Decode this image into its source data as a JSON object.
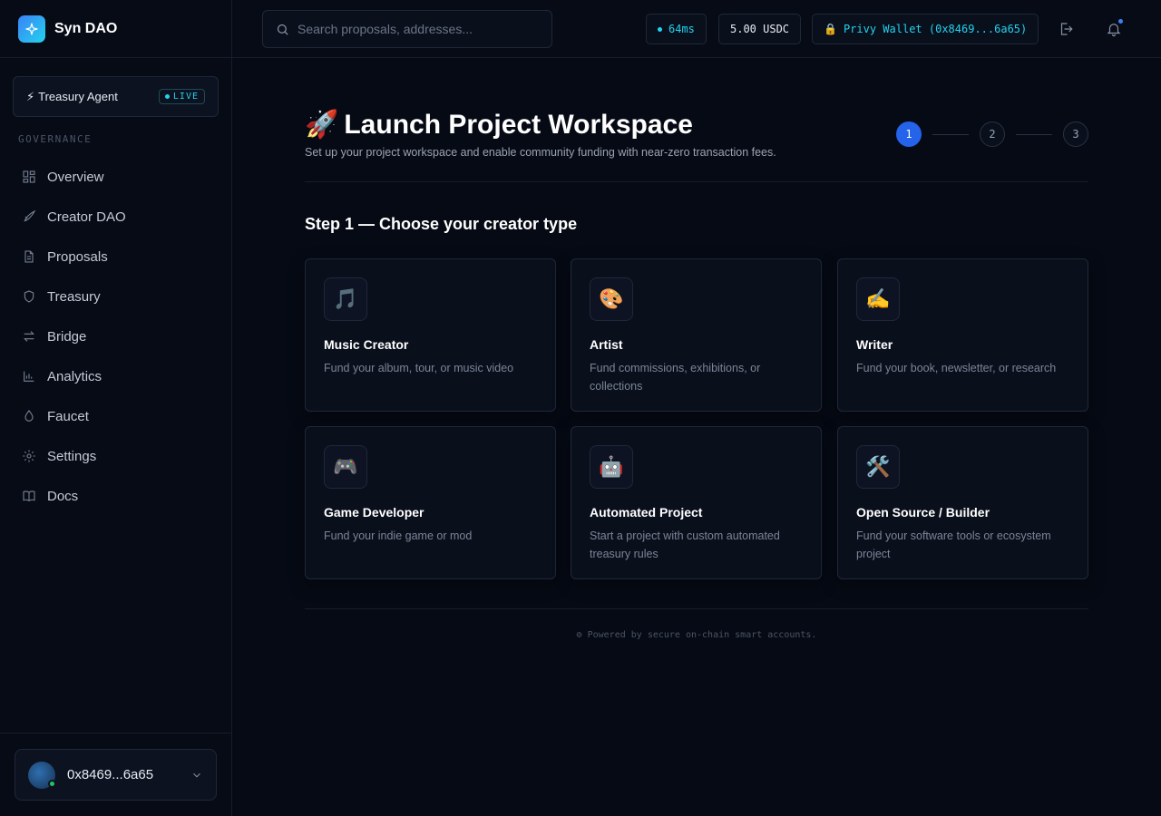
{
  "brand": {
    "name": "Syn DAO"
  },
  "agent": {
    "label": "Treasury Agent",
    "status": "LIVE"
  },
  "sidebar": {
    "section_label": "GOVERNANCE",
    "items": [
      {
        "label": "Overview",
        "icon": "grid-icon"
      },
      {
        "label": "Creator DAO",
        "icon": "rocket-icon"
      },
      {
        "label": "Proposals",
        "icon": "document-icon"
      },
      {
        "label": "Treasury",
        "icon": "shield-icon"
      },
      {
        "label": "Bridge",
        "icon": "arrows-icon"
      },
      {
        "label": "Analytics",
        "icon": "bar-chart-icon"
      },
      {
        "label": "Faucet",
        "icon": "droplet-icon"
      },
      {
        "label": "Settings",
        "icon": "gear-icon"
      },
      {
        "label": "Docs",
        "icon": "book-icon"
      }
    ],
    "user": {
      "address": "0x8469...6a65"
    }
  },
  "topbar": {
    "search_placeholder": "Search proposals, addresses...",
    "latency": "64ms",
    "balance": "5.00 USDC",
    "wallet": "Privy Wallet (0x8469...6a65)"
  },
  "page": {
    "title": "Launch Project Workspace",
    "title_emoji": "🚀",
    "subtitle": "Set up your project workspace and enable community funding with near-zero transaction fees.",
    "steps": [
      "1",
      "2",
      "3"
    ],
    "active_step": 1,
    "step_heading": "Step 1 — Choose your creator type",
    "creator_types": [
      {
        "emoji": "🎵",
        "title": "Music Creator",
        "desc": "Fund your album, tour, or music video"
      },
      {
        "emoji": "🎨",
        "title": "Artist",
        "desc": "Fund commissions, exhibitions, or collections"
      },
      {
        "emoji": "✍️",
        "title": "Writer",
        "desc": "Fund your book, newsletter, or research"
      },
      {
        "emoji": "🎮",
        "title": "Game Developer",
        "desc": "Fund your indie game or mod"
      },
      {
        "emoji": "🤖",
        "title": "Automated Project",
        "desc": "Start a project with custom automated treasury rules"
      },
      {
        "emoji": "🛠️",
        "title": "Open Source / Builder",
        "desc": "Fund your software tools or ecosystem project"
      }
    ],
    "footer_note": "Powered by secure on-chain smart accounts."
  },
  "colors": {
    "accent": "#2563eb",
    "cyan": "#22d3ee",
    "background": "#060a14"
  }
}
